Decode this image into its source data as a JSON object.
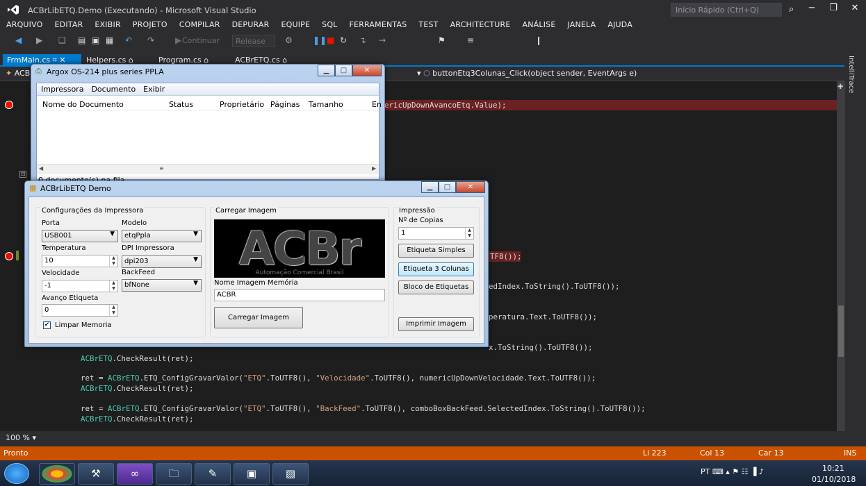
{
  "window": {
    "title": "ACBrLibETQ.Demo (Executando) - Microsoft Visual Studio",
    "quick_launch": "Início Rápido (Ctrl+Q)"
  },
  "menu": [
    "ARQUIVO",
    "EDITAR",
    "EXIBIR",
    "PROJETO",
    "COMPILAR",
    "DEPURAR",
    "EQUIPE",
    "SQL",
    "FERRAMENTAS",
    "TEST",
    "ARCHITECTURE",
    "ANÁLISE",
    "JANELA",
    "AJUDA"
  ],
  "toolbar": {
    "continue": "Continuar",
    "config": "Release"
  },
  "tabs": [
    "FrmMain.cs",
    "Helpers.cs",
    "Program.cs",
    "ACBrETQ.cs"
  ],
  "nav": {
    "left": "ACB",
    "method": "buttonEtq3Colunas_Click(object sender, EventArgs e)"
  },
  "code": {
    "l1": "ericUpDownAvancoEtq.Value);",
    "l2": "TF8());",
    "l3": "edIndex.ToString().ToUTF8());",
    "l4": "peratura.Text.ToUTF8());",
    "l5": "x.ToString().ToUTF8());",
    "l6_obj": "ACBrETQ",
    "l6_rest": ".CheckResult(ret);",
    "l7_a": "ret = ",
    "l7_cls": "ACBrETQ",
    "l7_b": ".ETQ_ConfigGravarValor(",
    "l7_s1": "\"ETQ\"",
    "l7_c": ".ToUTF8(), ",
    "l7_s2": "\"Velocidade\"",
    "l7_d": ".ToUTF8(), numericUpDownVelocidade.Text.ToUTF8());",
    "l8_obj": "ACBrETQ",
    "l8_rest": ".CheckResult(ret);",
    "l9_a": "ret = ",
    "l9_cls": "ACBrETQ",
    "l9_b": ".ETQ_ConfigGravarValor(",
    "l9_s1": "\"ETQ\"",
    "l9_c": ".ToUTF8(), ",
    "l9_s2": "\"BackFeed\"",
    "l9_d": ".ToUTF8(), comboBoxBackFeed.SelectedIndex.ToString().ToUTF8());",
    "l10_obj": "ACBrETQ",
    "l10_rest": ".CheckResult(ret);"
  },
  "side_panel": "IntelliTrace",
  "zoom": "100 %",
  "status": {
    "left": "Pronto",
    "line": "Li 223",
    "col": "Col 13",
    "car": "Car 13",
    "mode": "INS"
  },
  "clock": {
    "time": "10:21",
    "date": "01/10/2018",
    "lang": "PT"
  },
  "argox": {
    "title": "Argox OS-214 plus series PPLA",
    "menu": [
      "Impressora",
      "Documento",
      "Exibir"
    ],
    "columns": [
      "Nome do Documento",
      "Status",
      "Proprietário",
      "Páginas",
      "Tamanho",
      "En"
    ],
    "status": "0 documento(s) na fila"
  },
  "demo": {
    "title": "ACBrLibETQ Demo",
    "config_group": "Configurações da Impressora",
    "porta_label": "Porta",
    "porta": "USB001",
    "modelo_label": "Modelo",
    "modelo": "etqPpla",
    "temp_label": "Temperatura",
    "temp": "10",
    "dpi_label": "DPI Impressora",
    "dpi": "dpi203",
    "vel_label": "Velocidade",
    "vel": "-1",
    "backfeed_label": "BackFeed",
    "backfeed": "bfNone",
    "avanco_label": "Avanço Etiqueta",
    "avanco": "0",
    "limpar": "Limpar Memoria",
    "image_group": "Carregar Imagem",
    "logo_text": "ACBr",
    "logo_sub": "Automação Comercial Brasil",
    "nome_label": "Nome Imagem Memória",
    "nome": "ACBR",
    "carregar_btn": "Carregar Imagem",
    "print_group": "Impressão",
    "copias_label": "Nº de Copias",
    "copias": "1",
    "btn_simples": "Etiqueta Simples",
    "btn_3col": "Etiqueta 3 Colunas",
    "btn_bloco": "Bloco de Etiquetas",
    "btn_imprimir": "Imprimir Imagem"
  }
}
